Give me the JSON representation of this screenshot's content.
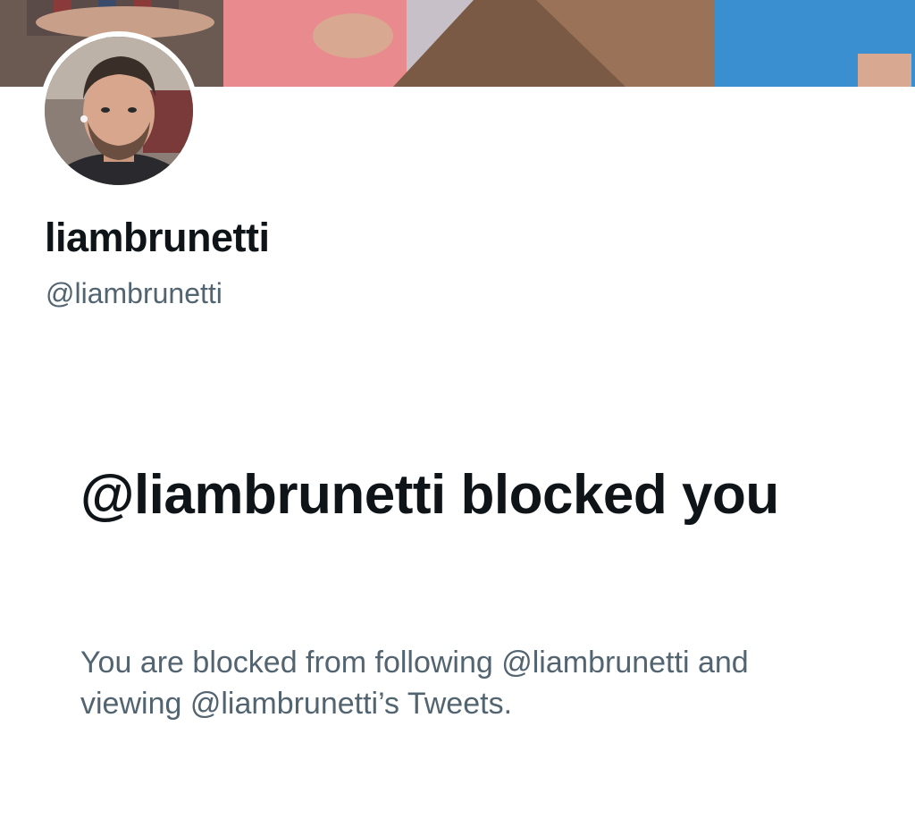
{
  "profile": {
    "display_name": "liambrunetti",
    "handle": "@liambrunetti"
  },
  "blocked_notice": {
    "title": "@liambrunetti blocked you",
    "description": "You are blocked from following @liambrunetti and viewing @liambrunetti’s Tweets."
  },
  "colors": {
    "primary_text": "#0f1419",
    "secondary_text": "#536471",
    "background": "#ffffff"
  }
}
